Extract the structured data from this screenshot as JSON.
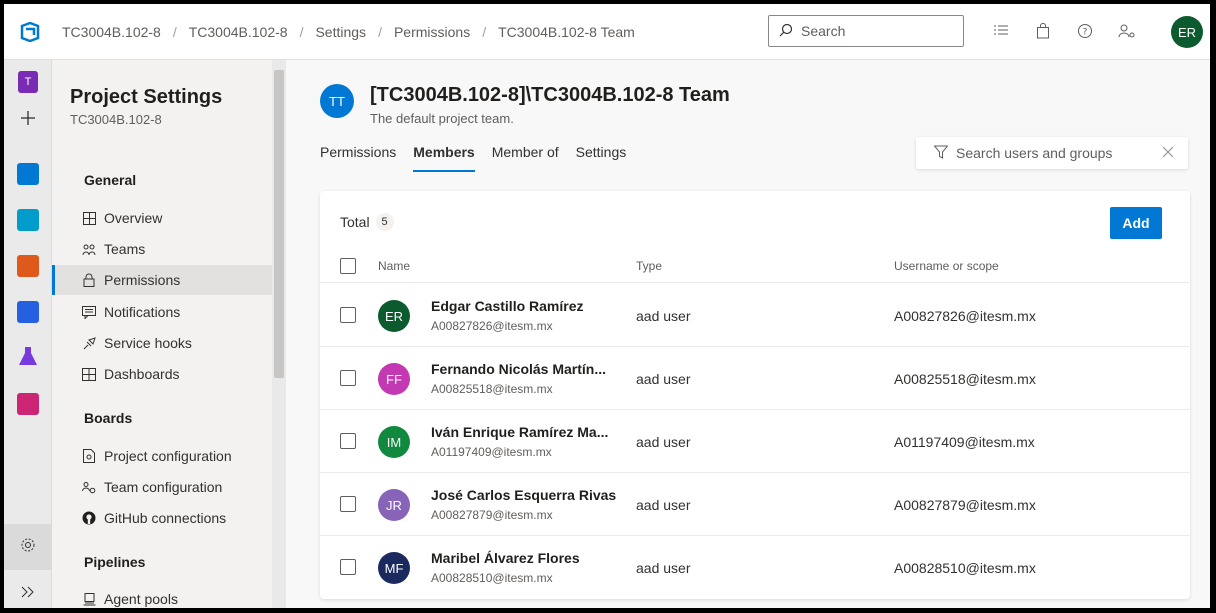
{
  "breadcrumbs": [
    "TC3004B.102-8",
    "TC3004B.102-8",
    "Settings",
    "Permissions",
    "TC3004B.102-8 Team"
  ],
  "search": {
    "placeholder": "Search"
  },
  "user": {
    "initials": "ER",
    "color": "#0b5b2e"
  },
  "rail": {
    "project_initial": "T"
  },
  "nav": {
    "title": "Project Settings",
    "subtitle": "TC3004B.102-8",
    "sections": {
      "general": "General",
      "boards": "Boards",
      "pipelines": "Pipelines"
    },
    "items": [
      {
        "label": "Overview",
        "icon": "overview-icon"
      },
      {
        "label": "Teams",
        "icon": "teams-icon"
      },
      {
        "label": "Permissions",
        "icon": "lock-icon",
        "selected": true
      },
      {
        "label": "Notifications",
        "icon": "notifications-icon"
      },
      {
        "label": "Service hooks",
        "icon": "service-hooks-icon"
      },
      {
        "label": "Dashboards",
        "icon": "dashboards-icon"
      },
      {
        "label": "Project configuration",
        "icon": "project-config-icon"
      },
      {
        "label": "Team configuration",
        "icon": "team-config-icon"
      },
      {
        "label": "GitHub connections",
        "icon": "github-icon"
      },
      {
        "label": "Agent pools",
        "icon": "agent-pools-icon"
      }
    ]
  },
  "team": {
    "initials": "TT",
    "title": "[TC3004B.102-8]\\TC3004B.102-8 Team",
    "description": "The default project team."
  },
  "tabs": [
    "Permissions",
    "Members",
    "Member of",
    "Settings"
  ],
  "active_tab": "Members",
  "filter": {
    "placeholder": "Search users and groups"
  },
  "members_panel": {
    "total_label": "Total",
    "total_count": "5",
    "add_label": "Add",
    "columns": {
      "name": "Name",
      "type": "Type",
      "scope": "Username or scope"
    },
    "rows": [
      {
        "initials": "ER",
        "color": "#0b5b2e",
        "name": "Edgar Castillo Ramírez",
        "email": "A00827826@itesm.mx",
        "type": "aad user",
        "scope": "A00827826@itesm.mx"
      },
      {
        "initials": "FF",
        "color": "#c239b3",
        "name": "Fernando Nicolás Martín...",
        "email": "A00825518@itesm.mx",
        "type": "aad user",
        "scope": "A00825518@itesm.mx"
      },
      {
        "initials": "IM",
        "color": "#10893e",
        "name": "Iván Enrique Ramírez Ma...",
        "email": "A01197409@itesm.mx",
        "type": "aad user",
        "scope": "A01197409@itesm.mx"
      },
      {
        "initials": "JR",
        "color": "#8764b8",
        "name": "José Carlos Esquerra Rivas",
        "email": "A00827879@itesm.mx",
        "type": "aad user",
        "scope": "A00827879@itesm.mx"
      },
      {
        "initials": "MF",
        "color": "#1b2a5e",
        "name": "Maribel Álvarez Flores",
        "email": "A00828510@itesm.mx",
        "type": "aad user",
        "scope": "A00828510@itesm.mx"
      }
    ]
  },
  "colors": {
    "accent": "#0078d4"
  }
}
